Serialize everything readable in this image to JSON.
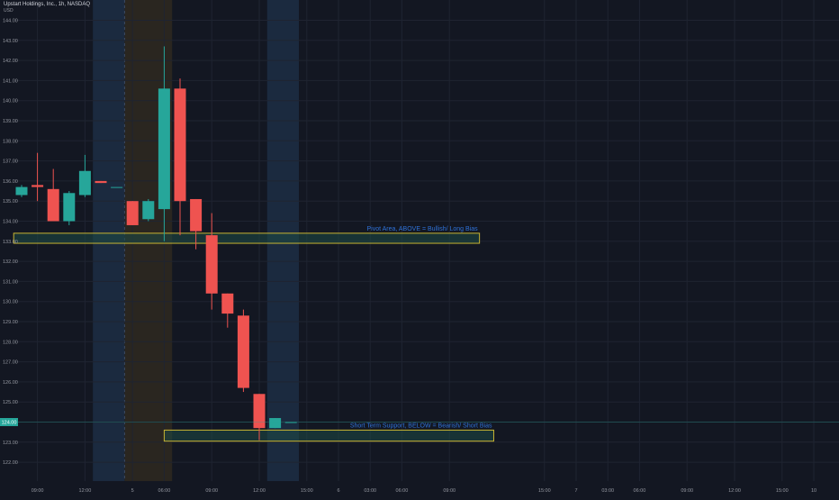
{
  "header": {
    "symbol_line": "Upstart Holdings, Inc., 1h, NASDAQ",
    "currency": "USD"
  },
  "colors": {
    "background": "#131722",
    "grid": "#1f2431",
    "up": "#26a69a",
    "down": "#ef5350",
    "zone_stroke": "#c8b432",
    "zone_fill": "#1e4a46",
    "annotation_text": "#2f72d8",
    "session_blue": "#1b2a3f",
    "session_brown": "#2a2620",
    "price_label_bg": "#26a69a"
  },
  "chart_data": {
    "type": "candlestick",
    "y_axis": {
      "range": [
        121.3,
        144.7
      ],
      "ticks": [
        144.0,
        143.0,
        142.0,
        141.0,
        140.0,
        139.0,
        138.0,
        137.0,
        136.0,
        135.0,
        134.0,
        133.0,
        132.0,
        131.0,
        130.0,
        129.0,
        128.0,
        127.0,
        126.0,
        125.0,
        124.0,
        123.0,
        122.0
      ],
      "tick_labels": [
        "144.00",
        "143.00",
        "142.00",
        "141.00",
        "140.00",
        "139.00",
        "138.00",
        "137.00",
        "136.00",
        "135.00",
        "134.00",
        "133.00",
        "132.00",
        "131.00",
        "130.00",
        "129.00",
        "128.00",
        "127.00",
        "126.00",
        "125.00",
        "124.00",
        "123.00",
        "122.00"
      ]
    },
    "x_axis": {
      "slot_count": 53,
      "tick_labels": [
        {
          "slot": 1,
          "label": "09:00"
        },
        {
          "slot": 4,
          "label": "12:00"
        },
        {
          "slot": 7,
          "label": "5"
        },
        {
          "slot": 9,
          "label": "06:00"
        },
        {
          "slot": 12,
          "label": "09:00"
        },
        {
          "slot": 15,
          "label": "12:00"
        },
        {
          "slot": 18,
          "label": "15:00"
        },
        {
          "slot": 20,
          "label": "6"
        },
        {
          "slot": 22,
          "label": "03:00"
        },
        {
          "slot": 24,
          "label": "06:00"
        },
        {
          "slot": 27,
          "label": "09:00"
        },
        {
          "slot": 33,
          "label": "15:00"
        },
        {
          "slot": 35,
          "label": "7"
        },
        {
          "slot": 37,
          "label": "03:00"
        },
        {
          "slot": 39,
          "label": "06:00"
        },
        {
          "slot": 42,
          "label": "09:00"
        },
        {
          "slot": 45,
          "label": "12:00"
        },
        {
          "slot": 48,
          "label": "15:00"
        },
        {
          "slot": 50,
          "label": "10"
        }
      ]
    },
    "candles": [
      {
        "slot": 0,
        "open": 135.3,
        "high": 135.8,
        "low": 135.2,
        "close": 135.7
      },
      {
        "slot": 1,
        "open": 135.8,
        "high": 137.4,
        "low": 135.0,
        "close": 135.7
      },
      {
        "slot": 2,
        "open": 135.6,
        "high": 136.6,
        "low": 134.0,
        "close": 134.0
      },
      {
        "slot": 3,
        "open": 134.0,
        "high": 135.5,
        "low": 133.8,
        "close": 135.4
      },
      {
        "slot": 4,
        "open": 135.3,
        "high": 137.3,
        "low": 135.2,
        "close": 136.5
      },
      {
        "slot": 5,
        "open": 136.0,
        "high": 136.0,
        "low": 135.9,
        "close": 135.9
      },
      {
        "slot": 6,
        "open": 135.7,
        "high": 135.7,
        "low": 135.7,
        "close": 135.7
      },
      {
        "slot": 7,
        "open": 135.0,
        "high": 135.0,
        "low": 133.8,
        "close": 133.8
      },
      {
        "slot": 8,
        "open": 134.1,
        "high": 135.1,
        "low": 134.0,
        "close": 135.0
      },
      {
        "slot": 9,
        "open": 134.6,
        "high": 142.7,
        "low": 133.0,
        "close": 140.6
      },
      {
        "slot": 10,
        "open": 140.6,
        "high": 141.1,
        "low": 133.3,
        "close": 135.0
      },
      {
        "slot": 11,
        "open": 135.1,
        "high": 135.1,
        "low": 132.6,
        "close": 133.5
      },
      {
        "slot": 12,
        "open": 133.3,
        "high": 134.4,
        "low": 129.6,
        "close": 130.4
      },
      {
        "slot": 13,
        "open": 130.4,
        "high": 130.4,
        "low": 128.7,
        "close": 129.4
      },
      {
        "slot": 14,
        "open": 129.3,
        "high": 129.6,
        "low": 125.5,
        "close": 125.7
      },
      {
        "slot": 15,
        "open": 125.4,
        "high": 125.4,
        "low": 123.1,
        "close": 123.7
      },
      {
        "slot": 16,
        "open": 123.7,
        "high": 124.2,
        "low": 123.7,
        "close": 124.2
      },
      {
        "slot": 17,
        "open": 124.0,
        "high": 124.0,
        "low": 124.0,
        "close": 124.0
      }
    ],
    "zones": [
      {
        "label": "Pivot Area, ABOVE = Bullish/ Long Bias",
        "price_top": 133.4,
        "price_bottom": 132.9,
        "slot_start": -0.5,
        "slot_end": 28.9
      },
      {
        "label": "Short Term Support, BELOW = Bearish/ Short Bias",
        "price_top": 123.6,
        "price_bottom": 123.05,
        "slot_start": 9.0,
        "slot_end": 29.8
      }
    ],
    "session_bands": [
      {
        "slot_start": 4.5,
        "slot_end": 6.5,
        "color": "blue"
      },
      {
        "slot_start": 6.5,
        "slot_end": 9.5,
        "color": "brown"
      },
      {
        "slot_start": 15.5,
        "slot_end": 17.5,
        "color": "blue"
      }
    ],
    "current_price": {
      "value": 124.0,
      "label": "124.00"
    }
  }
}
